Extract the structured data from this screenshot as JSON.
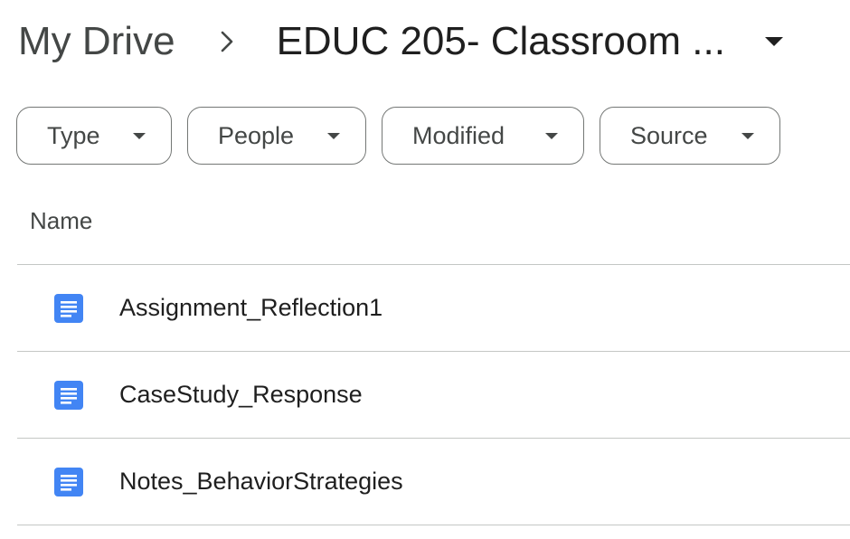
{
  "breadcrumb": {
    "root_label": "My Drive",
    "separator_icon": "chevron-right-icon",
    "current_label": "EDUC 205- Classroom ...",
    "current_caret_icon": "caret-down-icon"
  },
  "filters": [
    {
      "label": "Type",
      "icon": "caret-down-icon"
    },
    {
      "label": "People",
      "icon": "caret-down-icon"
    },
    {
      "label": "Modified",
      "icon": "caret-down-icon"
    },
    {
      "label": "Source",
      "icon": "caret-down-icon"
    }
  ],
  "table": {
    "columns": [
      "Name"
    ],
    "rows": [
      {
        "name": "Assignment_Reflection1",
        "icon": "google-docs-icon"
      },
      {
        "name": "CaseStudy_Response",
        "icon": "google-docs-icon"
      },
      {
        "name": "Notes_BehaviorStrategies",
        "icon": "google-docs-icon"
      }
    ]
  },
  "colors": {
    "docs_blue": "#4285f4",
    "divider": "#c4c7c5",
    "chip_border": "#747775"
  }
}
